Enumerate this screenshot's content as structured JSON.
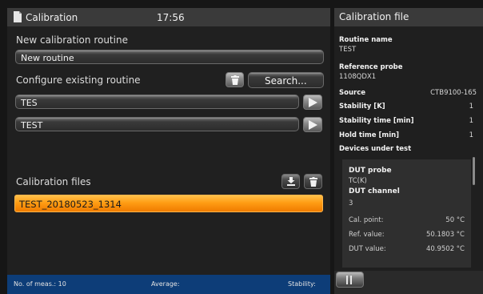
{
  "header": {
    "title": "Calibration",
    "time": "17:56"
  },
  "new_routine": {
    "label": "New calibration routine",
    "value": "New routine"
  },
  "existing": {
    "label": "Configure existing routine",
    "search_label": "Search...",
    "routines": [
      "TES",
      "TEST"
    ]
  },
  "files": {
    "label": "Calibration files",
    "items": [
      "TEST_20180523_1314"
    ]
  },
  "status": {
    "meas": "No. of meas.: 10",
    "average": "Average:",
    "stability": "Stability:"
  },
  "panel": {
    "title": "Calibration file",
    "routine_name_label": "Routine name",
    "routine_name": "TEST",
    "ref_probe_label": "Reference probe",
    "ref_probe": "1108QDX1",
    "source_label": "Source",
    "source": "CTB9100-165",
    "stability_label": "Stability [K]",
    "stability": "1",
    "stab_time_label": "Stability time [min]",
    "stab_time": "1",
    "hold_time_label": "Hold time [min]",
    "hold_time": "1",
    "dut_label": "Devices under test",
    "dut": {
      "probe_label": "DUT probe",
      "probe": "TC(K)",
      "channel_label": "DUT channel",
      "channel": "3",
      "cal_point_label": "Cal. point:",
      "cal_point": "50 °C",
      "ref_value_label": "Ref. value:",
      "ref_value": "50.1803 °C",
      "dut_value_label": "DUT value:",
      "dut_value": "40.9502 °C"
    }
  },
  "colors": {
    "accent": "#ff9d14",
    "status_bar": "#0d3d78"
  }
}
